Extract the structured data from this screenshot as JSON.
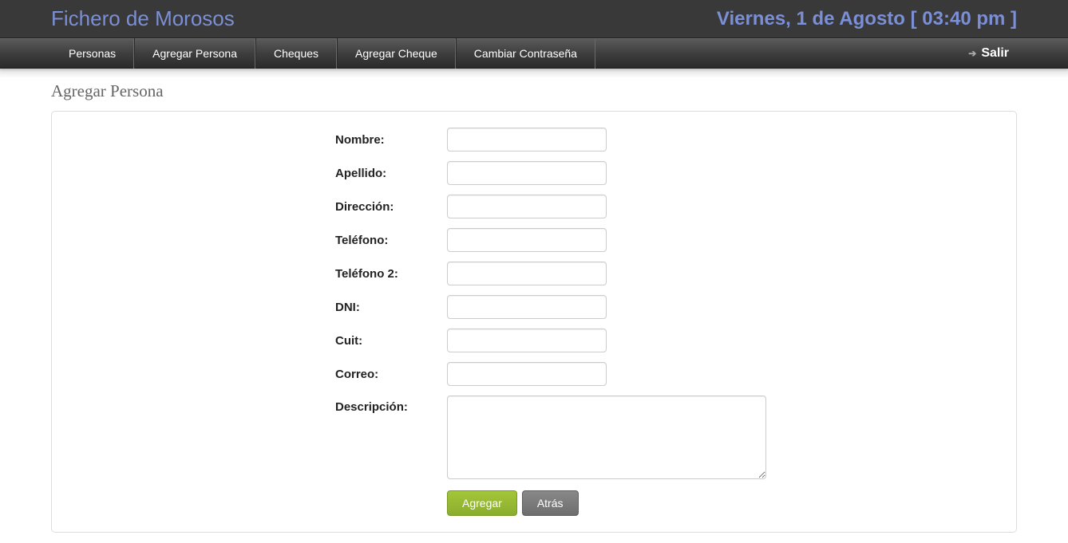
{
  "header": {
    "app_title": "Fichero de Morosos",
    "datetime": "Viernes, 1 de Agosto [ 03:40 pm ]"
  },
  "nav": {
    "items": [
      "Personas",
      "Agregar Persona",
      "Cheques",
      "Agregar Cheque",
      "Cambiar Contraseña"
    ],
    "logout": "Salir"
  },
  "page": {
    "title": "Agregar Persona"
  },
  "form": {
    "fields": {
      "nombre": {
        "label": "Nombre:",
        "value": ""
      },
      "apellido": {
        "label": "Apellido:",
        "value": ""
      },
      "direccion": {
        "label": "Dirección:",
        "value": ""
      },
      "telefono": {
        "label": "Teléfono:",
        "value": ""
      },
      "telefono2": {
        "label": "Teléfono 2:",
        "value": ""
      },
      "dni": {
        "label": "DNI:",
        "value": ""
      },
      "cuit": {
        "label": "Cuit:",
        "value": ""
      },
      "correo": {
        "label": "Correo:",
        "value": ""
      },
      "descripcion": {
        "label": "Descripción:",
        "value": ""
      }
    },
    "buttons": {
      "submit": "Agregar",
      "back": "Atrás"
    }
  }
}
